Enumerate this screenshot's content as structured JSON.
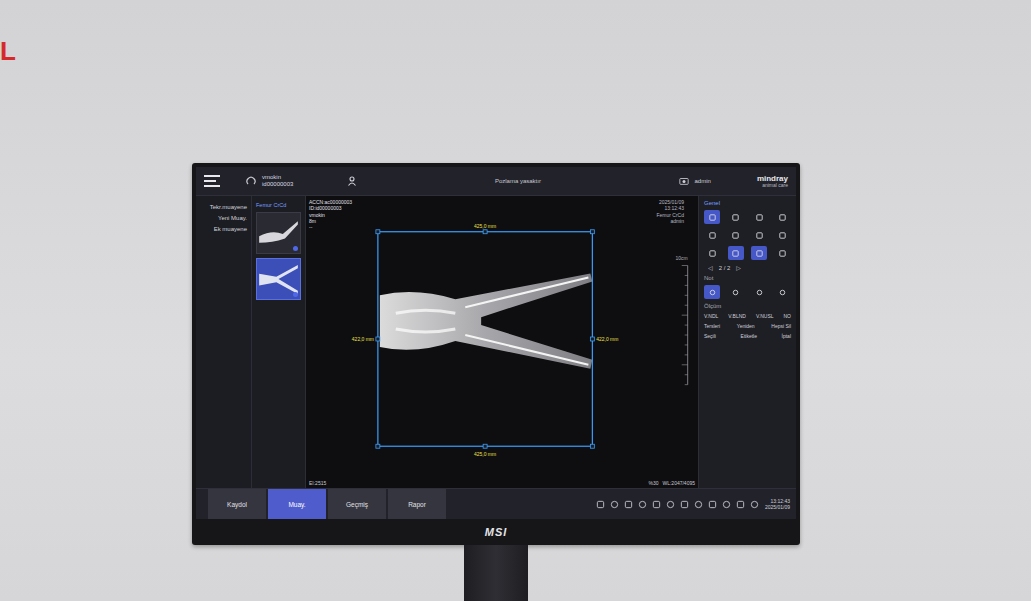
{
  "corner_logo": "L",
  "topbar": {
    "patient_name": "vmokin",
    "patient_id": "id00000003",
    "status": "Pozlama yasaktır",
    "user": "admin",
    "brand": "mindray",
    "brand_sub": "animal care"
  },
  "left_menu": [
    {
      "label": "Tekr.muayene"
    },
    {
      "label": "Yeni Muay."
    },
    {
      "label": "Ek muayene"
    }
  ],
  "thumbnails": {
    "title": "Femur CrCd",
    "items": [
      {
        "selected": false
      },
      {
        "selected": true
      }
    ]
  },
  "viewer": {
    "info": [
      "ACCN:ac00000003",
      "ID:id00000003",
      "vmokin",
      "8m",
      "--"
    ],
    "info_right": [
      "2025/01/09",
      "13:12:43",
      "Femur CrCd",
      "admin"
    ],
    "measurements": {
      "top": "425,0 mm",
      "left": "422,0 mm",
      "right": "422,0 mm",
      "bottom": "425,0 mm"
    },
    "scale": "10cm",
    "footer_left": "EI:2515",
    "footer_right": [
      "%30",
      "WL:2047/4095"
    ]
  },
  "toolbar": {
    "title": "Genel",
    "icon_rows": [
      [
        {
          "selected": true
        },
        {
          "selected": false
        },
        {
          "selected": false
        },
        {
          "selected": false
        }
      ],
      [
        {
          "selected": false
        },
        {
          "selected": false
        },
        {
          "selected": false
        },
        {
          "selected": false
        }
      ],
      [
        {
          "selected": false
        },
        {
          "selected": true
        },
        {
          "selected": true
        },
        {
          "selected": false
        }
      ]
    ],
    "pager": {
      "prev": "◁",
      "label": "2 / 2",
      "next": "▷"
    },
    "note_label": "Not",
    "note_icons": [
      {
        "selected": true
      },
      {
        "selected": false
      },
      {
        "selected": false
      },
      {
        "selected": false
      }
    ],
    "measure_label": "Ölçüm",
    "measure_tools": [
      "V.NDL",
      "V.BLND",
      "V.NUSL",
      "NO"
    ],
    "actions": [
      "Tersleri",
      "Yeniden",
      "Hepsi Sil"
    ],
    "actions2": [
      "Seçili",
      "Etiketle",
      "İptal"
    ]
  },
  "bottombar": {
    "tabs": [
      {
        "label": "Kaydol",
        "selected": false
      },
      {
        "label": "Muay.",
        "selected": true
      },
      {
        "label": "Geçmiş",
        "selected": false
      },
      {
        "label": "Rapor",
        "selected": false
      }
    ],
    "time": "13:12:43",
    "date": "2025/01/09"
  },
  "monitor": {
    "logo": "MSI"
  }
}
